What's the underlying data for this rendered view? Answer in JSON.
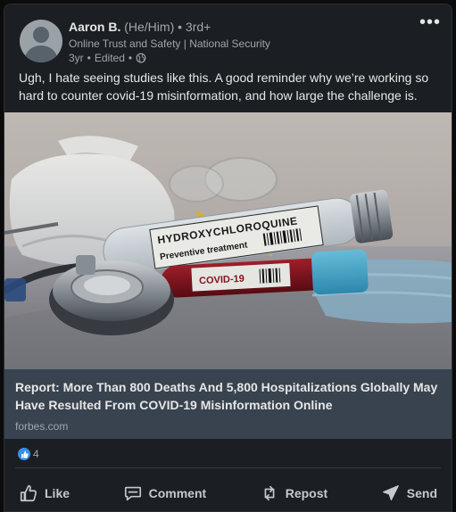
{
  "author": {
    "name": "Aaron B.",
    "pronouns": "(He/Him)",
    "separator": "•",
    "degree": "3rd+",
    "headline": "Online Trust and Safety | National Security",
    "time": "3yr",
    "edited": "Edited",
    "visibility_icon": "globe-icon"
  },
  "menu": {
    "icon": "more-options-icon",
    "label": "•••"
  },
  "post": {
    "text": "Ugh, I hate seeing studies like this. A good reminder why we’re working so hard to counter covid-19 misinformation, and how large the challenge is."
  },
  "article": {
    "image": {
      "tube_label_line1": "HYDROXYCHLOROQUINE",
      "tube_label_line2": "Preventive treatment",
      "sample_label": "COVID-19"
    },
    "title": "Report: More Than 800 Deaths And 5,800 Hospitalizations Globally May Have Resulted From COVID-19 Misinformation Online",
    "source": "forbes.com"
  },
  "social": {
    "reaction_icon": "like-reaction-icon",
    "reaction_count": "4"
  },
  "actions": [
    {
      "label": "Like",
      "icon": "thumbs-up-icon"
    },
    {
      "label": "Comment",
      "icon": "comment-icon"
    },
    {
      "label": "Repost",
      "icon": "repost-icon"
    },
    {
      "label": "Send",
      "icon": "send-icon"
    }
  ],
  "colors": {
    "card": "#1b1f23",
    "article_info": "#38434f",
    "text": "#e6e6e6",
    "muted": "#a0a6ab",
    "like_badge": "#378fe9"
  }
}
